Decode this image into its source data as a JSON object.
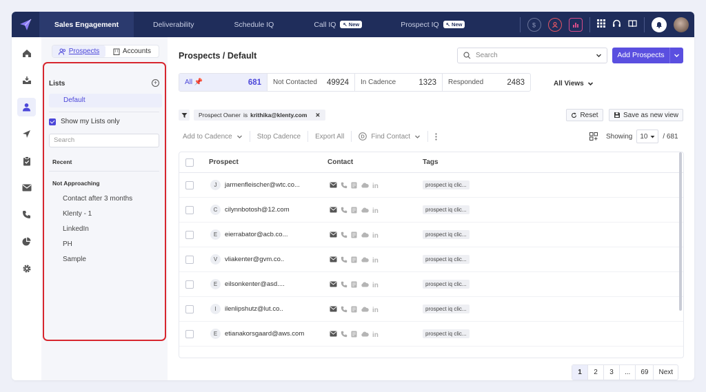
{
  "nav": {
    "tabs": [
      {
        "label": "Sales Engagement",
        "active": true
      },
      {
        "label": "Deliverability"
      },
      {
        "label": "Schedule IQ"
      },
      {
        "label": "Call IQ",
        "badge": "New"
      },
      {
        "label": "Prospect IQ",
        "badge": "New"
      }
    ],
    "icons": [
      "dollar-icon",
      "user-circle-icon",
      "chart-icon",
      "grid-icon",
      "headset-icon",
      "book-icon",
      "bell-icon"
    ]
  },
  "rail": [
    "home-icon",
    "inbox-icon",
    "user-icon",
    "send-icon",
    "clipboard-icon",
    "mail-icon",
    "phone-icon",
    "pie-chart-icon",
    "settings-icon"
  ],
  "listpanel": {
    "tabs": [
      "Prospects",
      "Accounts"
    ],
    "heading": "Lists",
    "default_item": "Default",
    "show_my_lists": "Show my Lists only",
    "search_placeholder": "Search",
    "recent_label": "Recent",
    "not_approaching_label": "Not Approaching",
    "items": [
      "Contact after 3 months",
      "Klenty - 1",
      "LinkedIn",
      "PH",
      "Sample"
    ]
  },
  "main": {
    "title": "Prospects / Default",
    "search_placeholder": "Search",
    "add_button": "Add Prospects",
    "stats": [
      {
        "label": "All",
        "value": "681"
      },
      {
        "label": "Not Contacted",
        "value": "49924"
      },
      {
        "label": "In Cadence",
        "value": "1323"
      },
      {
        "label": "Responded",
        "value": "2483"
      }
    ],
    "all_views": "All Views",
    "filter": {
      "field": "Prospect Owner",
      "op": "is",
      "value": "krithika@klenty.com"
    },
    "reset": "Reset",
    "save_view": "Save as new view",
    "toolbar": {
      "add_to_cadence": "Add to Cadence",
      "stop_cadence": "Stop Cadence",
      "export_all": "Export All",
      "find_contact": "Find Contact"
    },
    "showing_label": "Showing",
    "page_size": "10",
    "total": "/ 681",
    "columns": {
      "prospect": "Prospect",
      "contact": "Contact",
      "tags": "Tags"
    },
    "rows": [
      {
        "initial": "J",
        "email": "jarmenfleischer@wtc.co...",
        "tag": "prospect iq clic..."
      },
      {
        "initial": "C",
        "email": "cilynnbotosh@12.com",
        "tag": "prospect iq clic..."
      },
      {
        "initial": "E",
        "email": "eierrabator@acb.co...",
        "tag": "prospect iq clic..."
      },
      {
        "initial": "V",
        "email": "vliakenter@gvm.co..",
        "tag": "prospect iq clic..."
      },
      {
        "initial": "E",
        "email": "eilsonkenter@asd....",
        "tag": "prospect iq clic..."
      },
      {
        "initial": "I",
        "email": "ilenlipshutz@lut.co..",
        "tag": "prospect iq clic..."
      },
      {
        "initial": "E",
        "email": "etianakorsgaard@aws.com",
        "tag": "prospect iq clic..."
      }
    ],
    "pagination": [
      "1",
      "2",
      "3",
      "...",
      "69",
      "Next"
    ]
  }
}
